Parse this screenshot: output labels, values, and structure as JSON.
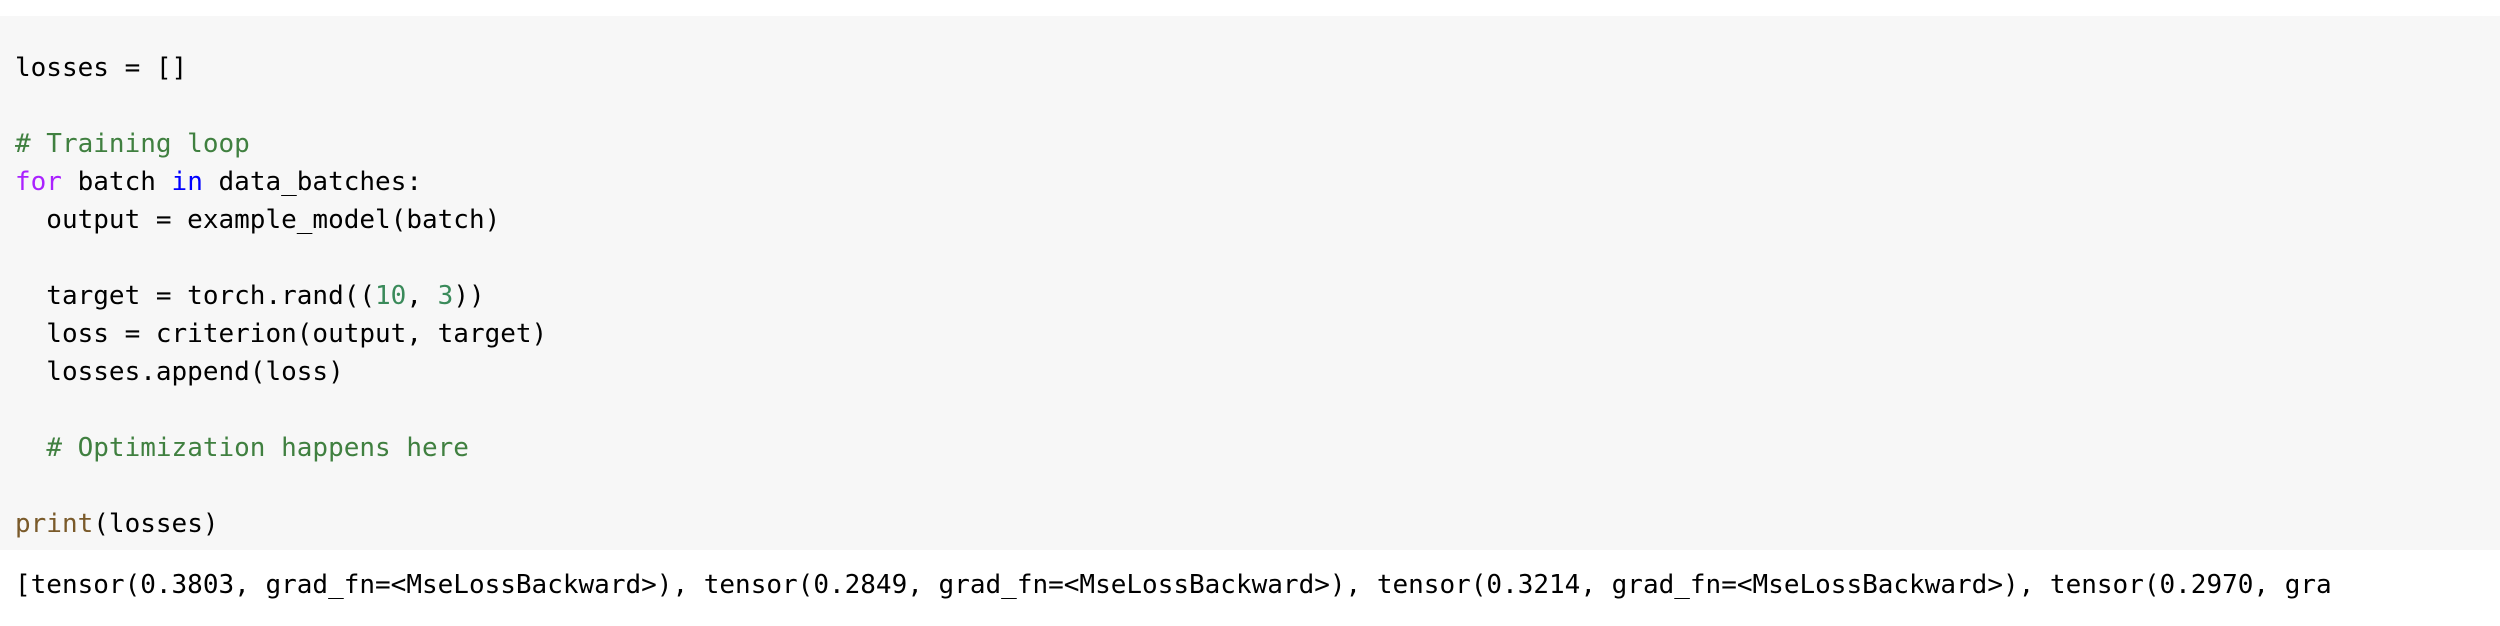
{
  "code": {
    "l1": "losses = []",
    "l3_comment": "# Training loop",
    "l4_for": "for",
    "l4_mid": " batch ",
    "l4_in": "in",
    "l4_end": " data_batches:",
    "l5": "  output = example_model(batch)",
    "l7_a": "  target = torch.rand((",
    "l7_n1": "10",
    "l7_b": ", ",
    "l7_n2": "3",
    "l7_c": "))",
    "l8": "  loss = criterion(output, target)",
    "l9": "  losses.append(loss)",
    "l11_indent": "  ",
    "l11_comment": "# Optimization happens here",
    "l13_print": "print",
    "l13_rest": "(losses)"
  },
  "output_text": "[tensor(0.3803, grad_fn=<MseLossBackward>), tensor(0.2849, grad_fn=<MseLossBackward>), tensor(0.3214, grad_fn=<MseLossBackward>), tensor(0.2970, gra",
  "colors": {
    "keyword_for": "#aa22ff",
    "keyword_in": "#0000ff",
    "comment": "#408040",
    "number": "#3a8a5a",
    "builtin": "#7a5a2a",
    "cell_background": "#f7f7f7"
  }
}
